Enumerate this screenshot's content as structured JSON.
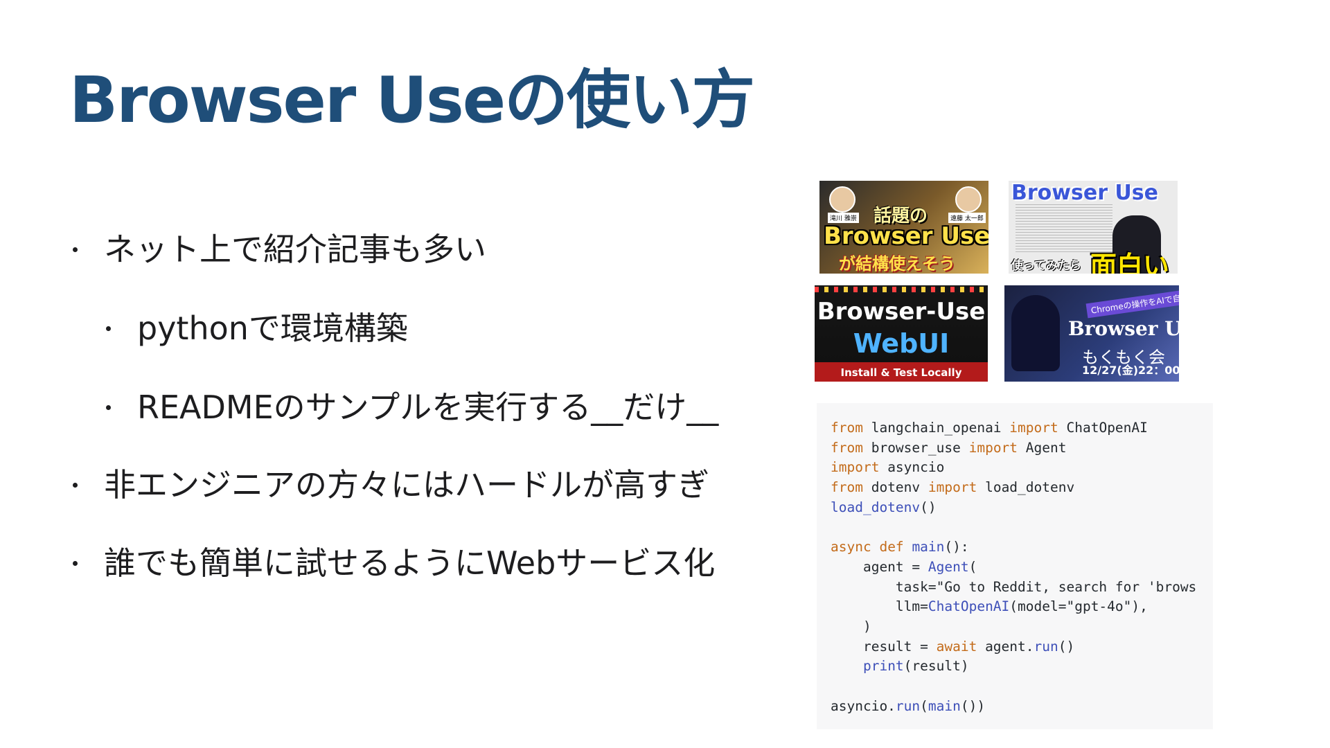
{
  "slide": {
    "title": "Browser Useの使い方",
    "bullets": [
      "ネット上で紹介記事も多い",
      "pythonで環境構築",
      "READMEのサンプルを実行する__だけ__",
      "非エンジニアの方々にはハードルが高すぎ",
      "誰でも簡単に試せるようにWebサービス化"
    ]
  },
  "thumbnails": [
    {
      "topic": "話題の",
      "title": "Browser Use",
      "sub": "が結構使えそう",
      "name_left": "滝川 雅崇",
      "name_right": "遠藤 太一郎"
    },
    {
      "title": "Browser Use",
      "sub1": "使ってみたら",
      "sub2": "面白い"
    },
    {
      "line1": "Browser-Use",
      "line2": "WebUI",
      "line3": "Install & Test Locally"
    },
    {
      "tag": "Chromeの操作をAIで自動化させろ!",
      "title": "Browser Use",
      "sub": "もくもく会",
      "date": "12/27(金)22：00"
    }
  ],
  "code": {
    "lines": [
      "from langchain_openai import ChatOpenAI",
      "from browser_use import Agent",
      "import asyncio",
      "from dotenv import load_dotenv",
      "load_dotenv()",
      "",
      "async def main():",
      "    agent = Agent(",
      "        task=\"Go to Reddit, search for 'brows",
      "        llm=ChatOpenAI(model=\"gpt-4o\"),",
      "    )",
      "    result = await agent.run()",
      "    print(result)",
      "",
      "asyncio.run(main())"
    ]
  }
}
